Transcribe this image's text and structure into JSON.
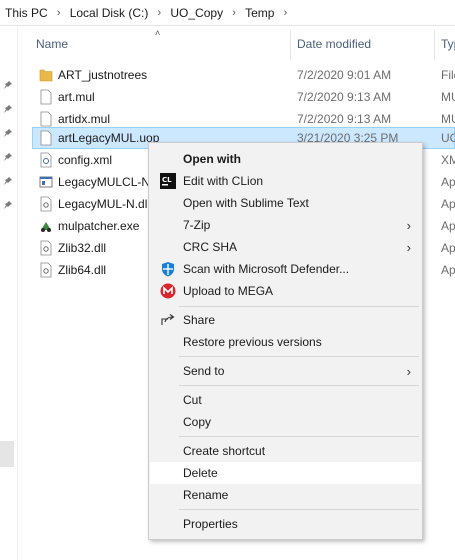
{
  "breadcrumb": {
    "items": [
      "This PC",
      "Local Disk (C:)",
      "UO_Copy",
      "Temp"
    ],
    "separator": "›"
  },
  "columns": {
    "name": "Name",
    "date": "Date modified",
    "type": "Typ"
  },
  "files": [
    {
      "name": "ART_justnotrees",
      "date": "7/2/2020 9:01 AM",
      "type": "File",
      "icon": "folder-icon"
    },
    {
      "name": "art.mul",
      "date": "7/2/2020 9:13 AM",
      "type": "MU",
      "icon": "file-icon"
    },
    {
      "name": "artidx.mul",
      "date": "7/2/2020 9:13 AM",
      "type": "MU",
      "icon": "file-icon"
    },
    {
      "name": "artLegacyMUL.uop",
      "date": "3/21/2020 3:25 PM",
      "type": "UO",
      "icon": "file-icon"
    },
    {
      "name": "config.xml",
      "date": "",
      "type": "XM",
      "icon": "xml-file-icon"
    },
    {
      "name": "LegacyMULCL-N",
      "date": "",
      "type": "Ap",
      "icon": "app-window-icon"
    },
    {
      "name": "LegacyMUL-N.dll",
      "date": "",
      "type": "Ap",
      "icon": "dll-file-icon"
    },
    {
      "name": "mulpatcher.exe",
      "date": "",
      "type": "Ap",
      "icon": "exe-icon"
    },
    {
      "name": "Zlib32.dll",
      "date": "",
      "type": "Ap",
      "icon": "dll-file-icon"
    },
    {
      "name": "Zlib64.dll",
      "date": "",
      "type": "Ap",
      "icon": "dll-file-icon"
    }
  ],
  "selected_file_index": 3,
  "context_menu": {
    "items": [
      {
        "label": "Open with",
        "bold": true,
        "icon": "",
        "submenu": false
      },
      {
        "label": "Edit with CLion",
        "bold": false,
        "icon": "clion-icon",
        "submenu": false
      },
      {
        "label": "Open with Sublime Text",
        "bold": false,
        "icon": "",
        "submenu": false
      },
      {
        "label": "7-Zip",
        "bold": false,
        "icon": "",
        "submenu": true
      },
      {
        "label": "CRC SHA",
        "bold": false,
        "icon": "",
        "submenu": true
      },
      {
        "label": "Scan with Microsoft Defender...",
        "bold": false,
        "icon": "defender-shield-icon",
        "submenu": false
      },
      {
        "label": "Upload to MEGA",
        "bold": false,
        "icon": "mega-icon",
        "submenu": false
      },
      {
        "label": "Share",
        "bold": false,
        "icon": "share-icon",
        "submenu": false
      },
      {
        "label": "Restore previous versions",
        "bold": false,
        "icon": "",
        "submenu": false
      },
      {
        "label": "Send to",
        "bold": false,
        "icon": "",
        "submenu": true
      },
      {
        "label": "Cut",
        "bold": false,
        "icon": "",
        "submenu": false
      },
      {
        "label": "Copy",
        "bold": false,
        "icon": "",
        "submenu": false
      },
      {
        "label": "Create shortcut",
        "bold": false,
        "icon": "",
        "submenu": false
      },
      {
        "label": "Delete",
        "bold": false,
        "icon": "",
        "submenu": false
      },
      {
        "label": "Rename",
        "bold": false,
        "icon": "",
        "submenu": false
      },
      {
        "label": "Properties",
        "bold": false,
        "icon": "",
        "submenu": false
      }
    ],
    "hovered_label": "Delete"
  },
  "colors": {
    "selection_bg": "#cce8ff",
    "menu_bg": "#f2f2f2",
    "folder": "#e8b94a",
    "mega_red": "#d9272e",
    "defender_blue": "#1a7fd6"
  }
}
